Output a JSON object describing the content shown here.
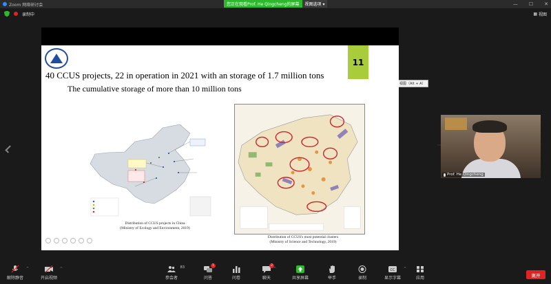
{
  "window": {
    "title": "Zoom 网络研讨会",
    "minimize": "—",
    "maximize": "☐",
    "close": "✕"
  },
  "share_banner": {
    "viewing_text": "您正在观看Prof. He Qingcheng的屏幕",
    "view_options": "视图选项 ▾"
  },
  "status": {
    "recording": "录制中"
  },
  "view_button": "视图",
  "view_tooltip": "视图（Alt + A）",
  "slide": {
    "number": "11",
    "title_line1": "40 CCUS projects, 22 in operation in 2021 with an storage of 1.7 million tons",
    "title_line2": "The cumulative storage of more than 10 million tons",
    "caption_left_1": "Distribution of CCUS projects in China",
    "caption_left_2": "(Ministry of Ecology and Environment, 2019)",
    "caption_right_1": "Distribution of CCUS's most potential clusters",
    "caption_right_2": "(Ministry of Science and Technology, 2019)"
  },
  "participant": {
    "name": "Prof. He Qingcheng"
  },
  "toolbar": {
    "unmute": "解除静音",
    "start_video": "开启视频",
    "participants": "参会者",
    "participants_count": "83",
    "qa": "问答",
    "qa_badge": "1",
    "poll": "问卷",
    "chat": "聊天",
    "chat_badge": "2",
    "share": "共享屏幕",
    "raise_hand": "举手",
    "record": "录制",
    "captions": "显示字幕",
    "apps": "应用",
    "leave": "离开"
  },
  "colors": {
    "leave_red": "#e02424",
    "share_green": "#2eb82e",
    "slide_number_bg": "#a8cc3a"
  }
}
